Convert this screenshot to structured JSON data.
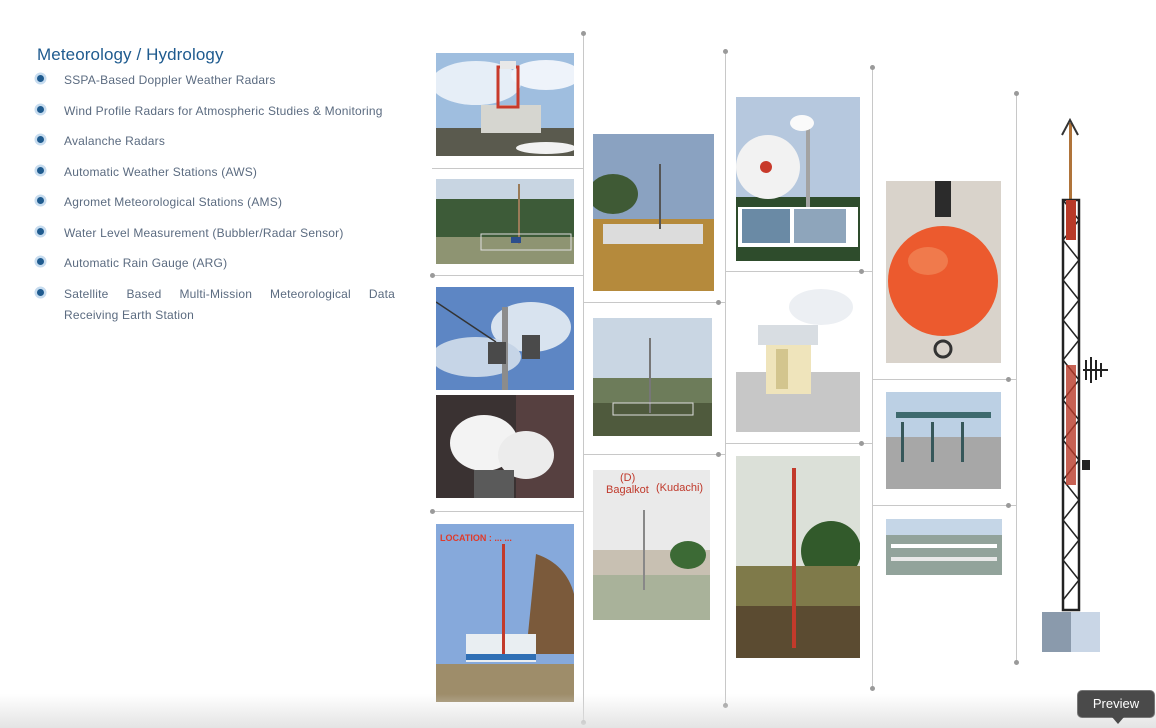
{
  "section": {
    "title": "Meteorology / Hydrology",
    "items": [
      {
        "label": "SSPA-Based Doppler Weather Radars"
      },
      {
        "label": "Wind Profile Radars for Atmospheric Studies & Monitoring"
      },
      {
        "label": "Avalanche Radars"
      },
      {
        "label": "Automatic Weather Stations (AWS)"
      },
      {
        "label": "Agromet Meteorological Stations (AMS)"
      },
      {
        "label": "Water Level Measurement (Bubbler/Radar Sensor)"
      },
      {
        "label": "Automatic Rain Gauge (ARG)"
      },
      {
        "label": "Satellite Based Multi-Mission Meteorological Data Receiving Earth Station"
      }
    ]
  },
  "gallery": {
    "captions": {
      "location": "LOCATION : ... ...",
      "bagalkot_letter": "(D)",
      "bagalkot": "Bagalkot",
      "kudachi": "(Kudachi)"
    }
  },
  "colors": {
    "accent": "#1f5b8f",
    "bullet_ring": "#c7dcef",
    "text": "#5b6b80",
    "caption_red": "#c0392b"
  },
  "tooltip": {
    "label": "Preview"
  }
}
